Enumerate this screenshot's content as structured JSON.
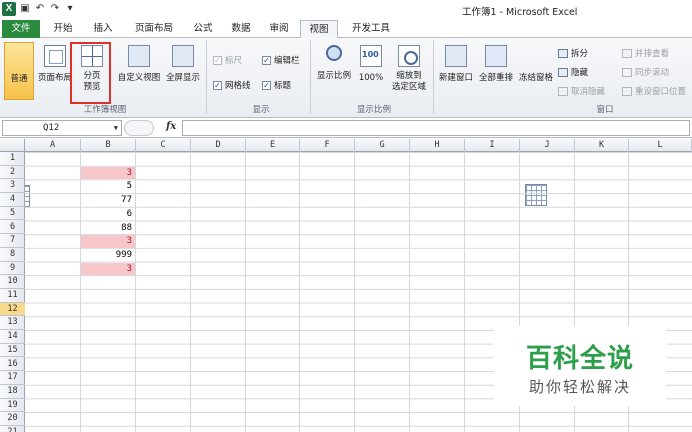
{
  "window": {
    "title": "工作簿1 - Microsoft Excel"
  },
  "tabs": [
    "文件",
    "开始",
    "插入",
    "页面布局",
    "公式",
    "数据",
    "审阅",
    "视图",
    "开发工具"
  ],
  "active_tab": "视图",
  "ribbon": {
    "workbook_views": {
      "group_label": "工作簿视图",
      "normal": "普通",
      "page_layout": "页面布局",
      "page_break_preview": "分页\n预览",
      "custom_views": "自定义视图",
      "full_screen": "全屏显示"
    },
    "show": {
      "group_label": "显示",
      "ruler": "标尺",
      "formula_bar": "编辑栏",
      "gridlines": "网格线",
      "headings": "标题"
    },
    "zoom": {
      "group_label": "显示比例",
      "zoom": "显示比例",
      "hundred": "100%",
      "zoom_to_selection": "缩放到\n选定区域"
    },
    "window": {
      "group_label": "窗口",
      "new_window": "新建窗口",
      "arrange_all": "全部重排",
      "freeze_panes": "冻结窗格",
      "split": "拆分",
      "hide": "隐藏",
      "unhide": "取消隐藏",
      "side_by_side": "并排查看",
      "sync_scroll": "同步滚动",
      "reset_position": "重设窗口位置"
    }
  },
  "formula_bar": {
    "name_box": "Q12",
    "fx": "fx",
    "content": ""
  },
  "columns": [
    "A",
    "B",
    "C",
    "D",
    "E",
    "F",
    "G",
    "H",
    "I",
    "J",
    "K",
    "L"
  ],
  "rows": [
    "1",
    "2",
    "3",
    "4",
    "5",
    "6",
    "7",
    "8",
    "9",
    "10",
    "11",
    "12",
    "13",
    "14",
    "15",
    "16",
    "17",
    "18",
    "19",
    "20",
    "21"
  ],
  "selected_row": "12",
  "cells_b": [
    {
      "row": 2,
      "value": "3",
      "duplicate": true
    },
    {
      "row": 3,
      "value": "5",
      "duplicate": false
    },
    {
      "row": 4,
      "value": "77",
      "duplicate": false
    },
    {
      "row": 5,
      "value": "6",
      "duplicate": false
    },
    {
      "row": 6,
      "value": "88",
      "duplicate": false
    },
    {
      "row": 7,
      "value": "3",
      "duplicate": true
    },
    {
      "row": 8,
      "value": "999",
      "duplicate": false
    },
    {
      "row": 9,
      "value": "3",
      "duplicate": true
    }
  ],
  "colors": {
    "file_tab": "#2a8a3e",
    "duplicate_fill": "#f7c6c9",
    "duplicate_text": "#b0121c",
    "highlight_box": "#e0302a",
    "watermark": "#2d9e4a"
  },
  "watermark": {
    "title": "百科全说",
    "subtitle": "助你轻松解决"
  }
}
